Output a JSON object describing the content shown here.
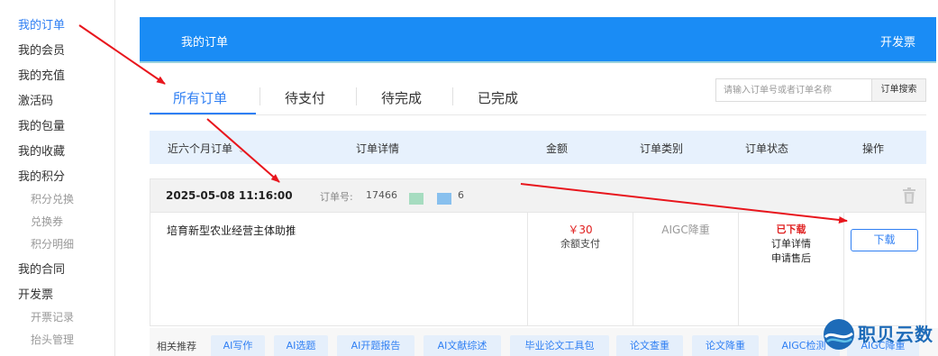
{
  "sidebar": {
    "items": [
      {
        "label": "我的订单",
        "active": true
      },
      {
        "label": "我的会员"
      },
      {
        "label": "我的充值"
      },
      {
        "label": "激活码"
      },
      {
        "label": "我的包量"
      },
      {
        "label": "我的收藏"
      },
      {
        "label": "我的积分"
      },
      {
        "label": "积分兑换",
        "sub": true
      },
      {
        "label": "兑换券",
        "sub": true
      },
      {
        "label": "积分明细",
        "sub": true
      },
      {
        "label": "我的合同"
      },
      {
        "label": "开发票"
      },
      {
        "label": "开票记录",
        "sub": true
      },
      {
        "label": "抬头管理",
        "sub": true
      }
    ]
  },
  "header": {
    "title": "我的订单",
    "invoice": "开发票",
    "bg_color": "#1a8cf5"
  },
  "tabs": [
    {
      "label": "所有订单",
      "active": true
    },
    {
      "label": "待支付"
    },
    {
      "label": "待完成"
    },
    {
      "label": "已完成"
    }
  ],
  "search": {
    "placeholder": "请输入订单号或者订单名称",
    "button": "订单搜索"
  },
  "table": {
    "headers": {
      "period": "近六个月订单",
      "detail": "订单详情",
      "amount": "金额",
      "category": "订单类别",
      "status": "订单状态",
      "action": "操作"
    }
  },
  "order": {
    "date": "2025-05-08 11:16:00",
    "number_label": "订单号:",
    "number_prefix": "17466",
    "number_suffix": "6",
    "product": "培育新型农业经营主体助推",
    "price": "￥30",
    "pay_method": "余额支付",
    "category": "AIGC降重",
    "status": "已下载",
    "detail_link": "订单详情",
    "after_sale_link": "申请售后",
    "download": "下载"
  },
  "related": {
    "label": "相关推荐",
    "chips": [
      "AI写作",
      "AI选题",
      "AI开题报告",
      "AI文献综述",
      "毕业论文工具包",
      "论文查重",
      "论文降重",
      "AIGC检测",
      "AIGC降重"
    ]
  },
  "watermark": {
    "text": "职贝云数"
  },
  "colors": {
    "accent": "#2f7ff3",
    "price": "#e02020",
    "annotation_arrow": "#e8161d"
  }
}
